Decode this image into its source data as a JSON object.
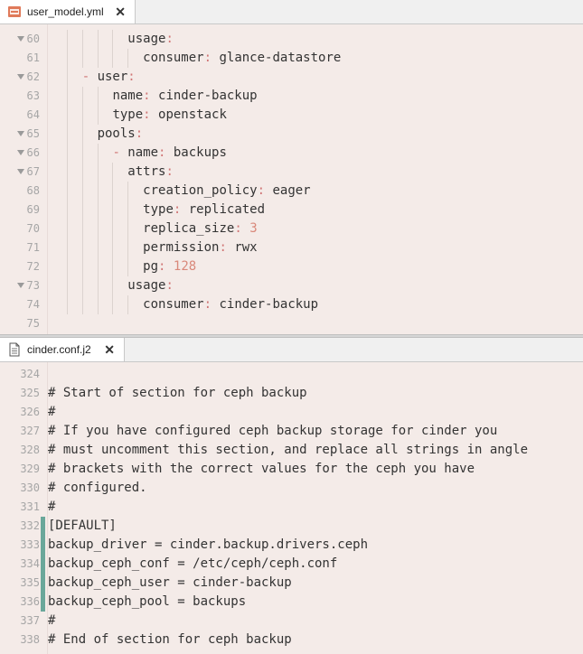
{
  "top": {
    "tab": {
      "name": "user_model.yml"
    },
    "lines": [
      {
        "num": "60",
        "fold": true,
        "parts": [
          {
            "t": "          "
          },
          {
            "t": "usage",
            "c": "k"
          },
          {
            "t": ":",
            "c": "p"
          }
        ]
      },
      {
        "num": "61",
        "fold": false,
        "parts": [
          {
            "t": "            "
          },
          {
            "t": "consumer",
            "c": "k"
          },
          {
            "t": ":",
            "c": "p"
          },
          {
            "t": " glance-datastore",
            "c": "v"
          }
        ]
      },
      {
        "num": "62",
        "fold": true,
        "parts": [
          {
            "t": "    "
          },
          {
            "t": "- ",
            "c": "p"
          },
          {
            "t": "user",
            "c": "k"
          },
          {
            "t": ":",
            "c": "p"
          }
        ]
      },
      {
        "num": "63",
        "fold": false,
        "parts": [
          {
            "t": "        "
          },
          {
            "t": "name",
            "c": "k"
          },
          {
            "t": ":",
            "c": "p"
          },
          {
            "t": " cinder-backup",
            "c": "v"
          }
        ]
      },
      {
        "num": "64",
        "fold": false,
        "parts": [
          {
            "t": "        "
          },
          {
            "t": "type",
            "c": "k"
          },
          {
            "t": ":",
            "c": "p"
          },
          {
            "t": " openstack",
            "c": "v"
          }
        ]
      },
      {
        "num": "65",
        "fold": true,
        "parts": [
          {
            "t": "      "
          },
          {
            "t": "pools",
            "c": "k"
          },
          {
            "t": ":",
            "c": "p"
          }
        ]
      },
      {
        "num": "66",
        "fold": true,
        "parts": [
          {
            "t": "        "
          },
          {
            "t": "- ",
            "c": "p"
          },
          {
            "t": "name",
            "c": "k"
          },
          {
            "t": ":",
            "c": "p"
          },
          {
            "t": " backups",
            "c": "v"
          }
        ]
      },
      {
        "num": "67",
        "fold": true,
        "parts": [
          {
            "t": "          "
          },
          {
            "t": "attrs",
            "c": "k"
          },
          {
            "t": ":",
            "c": "p"
          }
        ]
      },
      {
        "num": "68",
        "fold": false,
        "parts": [
          {
            "t": "            "
          },
          {
            "t": "creation_policy",
            "c": "k"
          },
          {
            "t": ":",
            "c": "p"
          },
          {
            "t": " eager",
            "c": "v"
          }
        ]
      },
      {
        "num": "69",
        "fold": false,
        "parts": [
          {
            "t": "            "
          },
          {
            "t": "type",
            "c": "k"
          },
          {
            "t": ":",
            "c": "p"
          },
          {
            "t": " replicated",
            "c": "v"
          }
        ]
      },
      {
        "num": "70",
        "fold": false,
        "parts": [
          {
            "t": "            "
          },
          {
            "t": "replica_size",
            "c": "k"
          },
          {
            "t": ":",
            "c": "p"
          },
          {
            "t": " "
          },
          {
            "t": "3",
            "c": "n"
          }
        ]
      },
      {
        "num": "71",
        "fold": false,
        "parts": [
          {
            "t": "            "
          },
          {
            "t": "permission",
            "c": "k"
          },
          {
            "t": ":",
            "c": "p"
          },
          {
            "t": " rwx",
            "c": "v"
          }
        ]
      },
      {
        "num": "72",
        "fold": false,
        "parts": [
          {
            "t": "            "
          },
          {
            "t": "pg",
            "c": "k"
          },
          {
            "t": ":",
            "c": "p"
          },
          {
            "t": " "
          },
          {
            "t": "128",
            "c": "n"
          }
        ]
      },
      {
        "num": "73",
        "fold": true,
        "parts": [
          {
            "t": "          "
          },
          {
            "t": "usage",
            "c": "k"
          },
          {
            "t": ":",
            "c": "p"
          }
        ]
      },
      {
        "num": "74",
        "fold": false,
        "parts": [
          {
            "t": "            "
          },
          {
            "t": "consumer",
            "c": "k"
          },
          {
            "t": ":",
            "c": "p"
          },
          {
            "t": " cinder-backup",
            "c": "v"
          }
        ]
      },
      {
        "num": "75",
        "fold": false,
        "parts": []
      }
    ]
  },
  "bottom": {
    "tab": {
      "name": "cinder.conf.j2"
    },
    "lines": [
      {
        "num": "324",
        "mod": false,
        "text": ""
      },
      {
        "num": "325",
        "mod": false,
        "text": "# Start of section for ceph backup"
      },
      {
        "num": "326",
        "mod": false,
        "text": "#"
      },
      {
        "num": "327",
        "mod": false,
        "text": "# If you have configured ceph backup storage for cinder you"
      },
      {
        "num": "328",
        "mod": false,
        "text": "# must uncomment this section, and replace all strings in angle"
      },
      {
        "num": "329",
        "mod": false,
        "text": "# brackets with the correct values for the ceph you have"
      },
      {
        "num": "330",
        "mod": false,
        "text": "# configured."
      },
      {
        "num": "331",
        "mod": false,
        "text": "#"
      },
      {
        "num": "332",
        "mod": true,
        "text": "[DEFAULT]"
      },
      {
        "num": "333",
        "mod": true,
        "text": "backup_driver = cinder.backup.drivers.ceph"
      },
      {
        "num": "334",
        "mod": true,
        "text": "backup_ceph_conf = /etc/ceph/ceph.conf"
      },
      {
        "num": "335",
        "mod": true,
        "text": "backup_ceph_user = cinder-backup"
      },
      {
        "num": "336",
        "mod": true,
        "text": "backup_ceph_pool = backups"
      },
      {
        "num": "337",
        "mod": false,
        "text": "#"
      },
      {
        "num": "338",
        "mod": false,
        "text": "# End of section for ceph backup"
      }
    ]
  },
  "icons": {
    "yaml_file": "yaml-file-icon",
    "text_file": "text-file-icon",
    "close": "close-icon",
    "fold": "fold-arrow-icon"
  },
  "colors": {
    "background": "#f4ebe8",
    "punctuation": "#d07575",
    "number": "#d9887a",
    "modified_bar": "#6aa79a"
  }
}
